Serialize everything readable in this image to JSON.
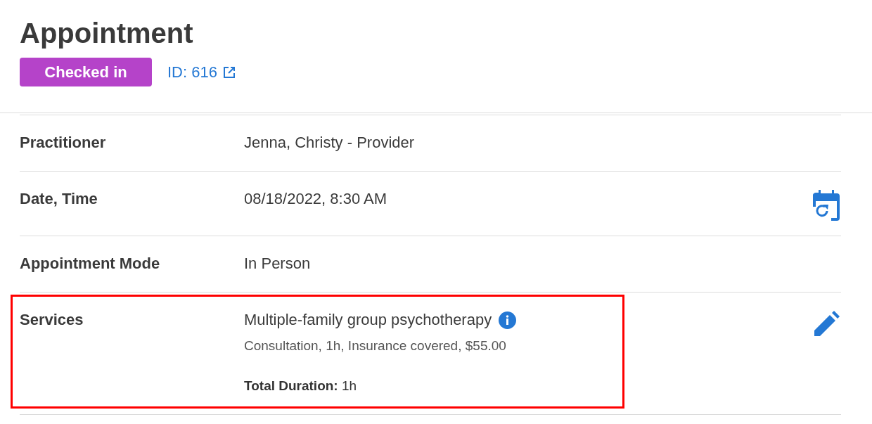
{
  "header": {
    "title": "Appointment",
    "status_badge": {
      "label": "Checked in",
      "color": "#b543c9"
    },
    "id_link": "ID: 616"
  },
  "rows": [
    {
      "kind": "text",
      "label": "Practitioner",
      "value": "Jenna, Christy - Provider",
      "highlighted": false
    },
    {
      "kind": "text",
      "label": "Date, Time",
      "value": "08/18/2022, 8:30 AM",
      "action": {
        "kind": "reschedule"
      },
      "highlighted": false
    },
    {
      "kind": "text",
      "label": "Appointment Mode",
      "value": "In Person",
      "highlighted": false
    },
    {
      "kind": "services",
      "label": "Services",
      "service": "Multiple-family group psychotherapy",
      "details": "Consultation, 1h, Insurance covered, $55.00",
      "total": "**Total Duration:** 1h",
      "action": {
        "kind": "edit"
      },
      "highlighted": true
    }
  ]
}
